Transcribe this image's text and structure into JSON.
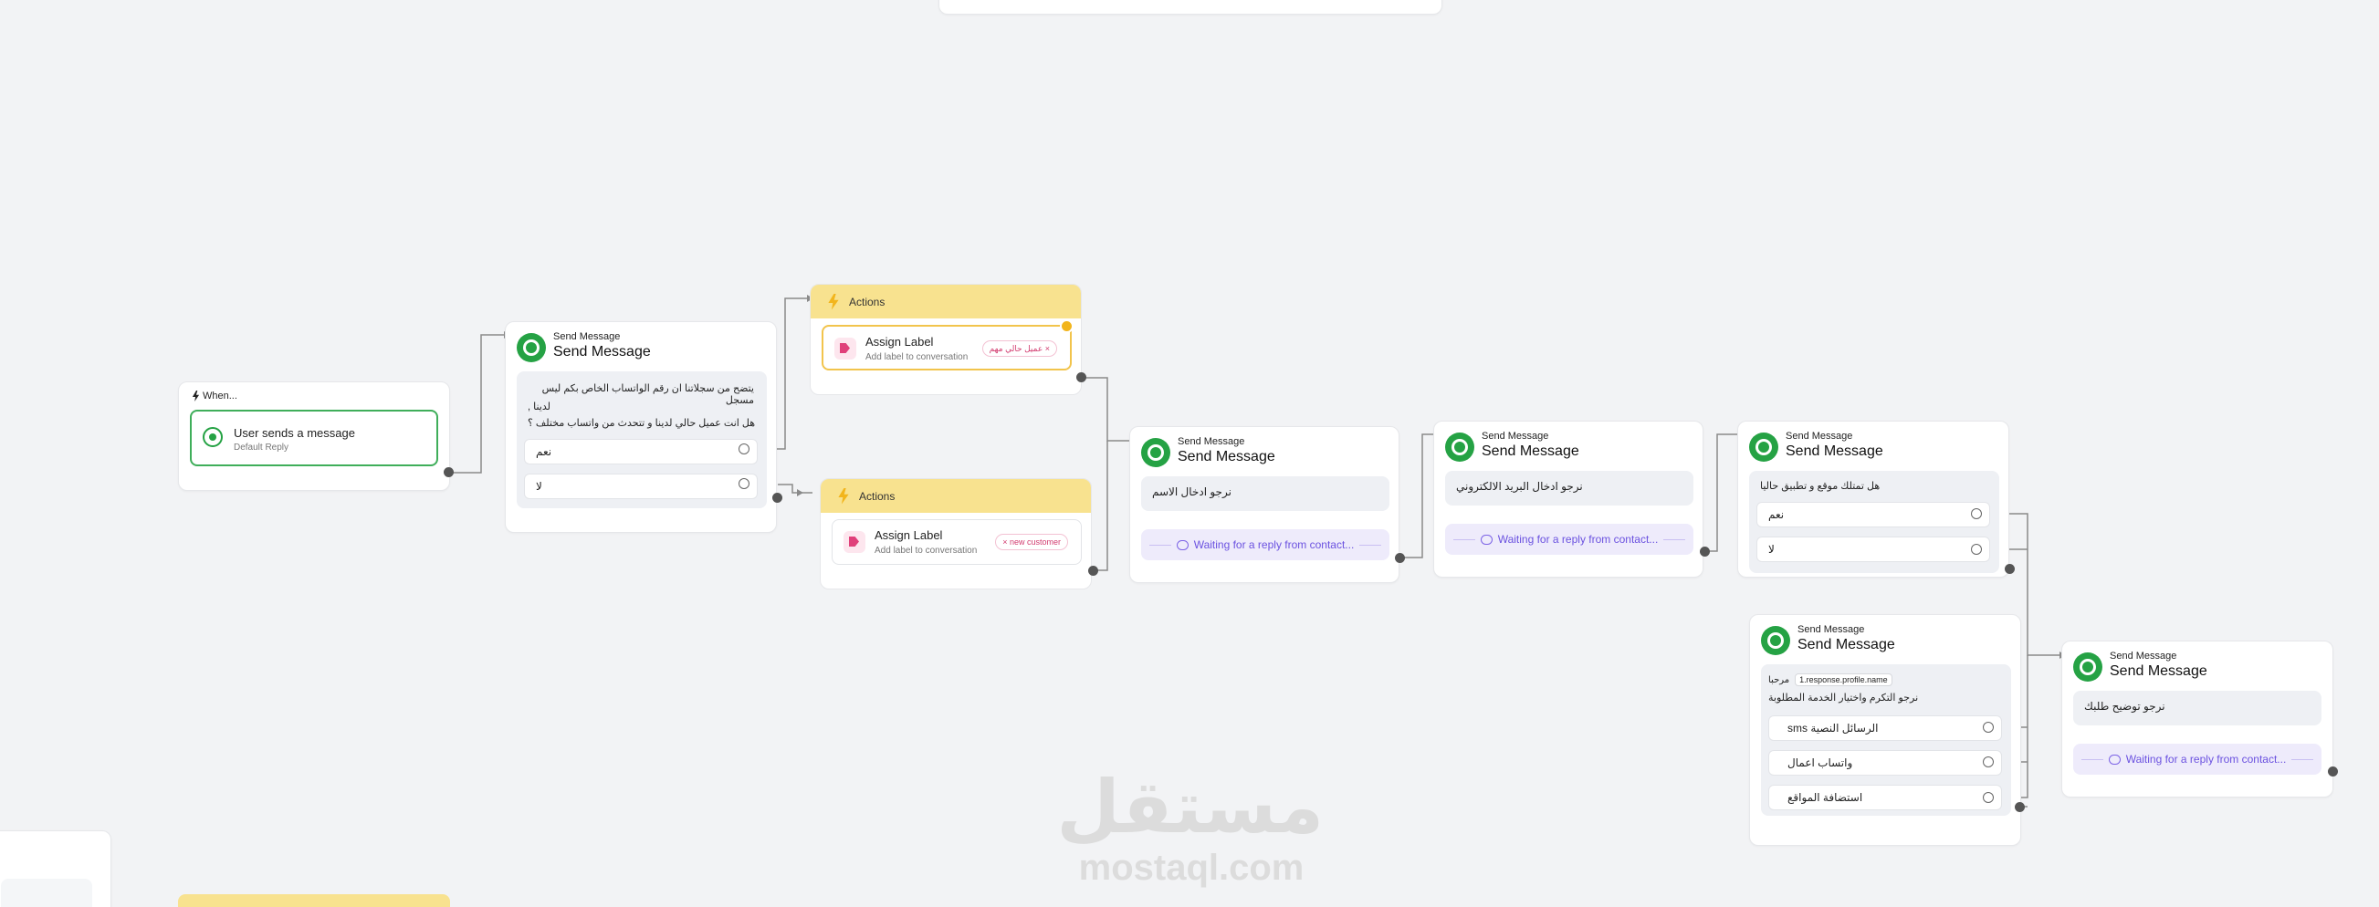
{
  "trigger": {
    "title": "When...",
    "event_title": "User sends a message",
    "event_subtitle": "Default Reply"
  },
  "node1": {
    "small_title": "Send Message",
    "title": "Send Message",
    "message_line1": "يتضح من سجلاتنا ان رقم الواتساب الخاص بكم ليس مسجل",
    "message_line2": "لدينا ,",
    "message_line3": "هل انت عميل حالي لدينا و تتحدث من واتساب مختلف ؟",
    "option_yes": "نعم",
    "option_no": "لا"
  },
  "action1": {
    "header": "Actions",
    "label_title": "Assign Label",
    "label_subtitle": "Add label to conversation",
    "tag": "عميل حالي مهم ×"
  },
  "action2": {
    "header": "Actions",
    "label_title": "Assign Label",
    "label_subtitle": "Add label to conversation",
    "tag": "× new customer"
  },
  "node2": {
    "small_title": "Send Message",
    "title": "Send Message",
    "message": "نرجو ادخال الاسم",
    "waiting": "Waiting for a reply from contact..."
  },
  "node3": {
    "small_title": "Send Message",
    "title": "Send Message",
    "message": "نرجو ادخال البريد الالكتروني",
    "waiting": "Waiting for a reply from contact..."
  },
  "node4": {
    "small_title": "Send Message",
    "title": "Send Message",
    "message": "هل تمتلك موقع و تطبيق حاليا",
    "option_yes": "نعم",
    "option_no": "لا"
  },
  "node5": {
    "small_title": "Send Message",
    "title": "Send Message",
    "greeting": "مرحبا",
    "variable": "1.response.profile.name",
    "message": "نرجو التكرم واختيار الخدمة المطلوبة",
    "option1": "sms الرسائل النصية",
    "option2": "واتساب اعمال",
    "option3": "استضافة المواقع"
  },
  "node6": {
    "small_title": "Send Message",
    "title": "Send Message",
    "message": "نرجو توضيح طلبك",
    "waiting": "Waiting for a reply from contact..."
  },
  "watermark": {
    "arabic": "مستقل",
    "latin": "mostaql.com"
  },
  "colors": {
    "whatsapp_green": "#25a244",
    "action_yellow": "#f8e28f",
    "waiting_purple": "#6b52e0",
    "tag_pink": "#d23a6e"
  }
}
